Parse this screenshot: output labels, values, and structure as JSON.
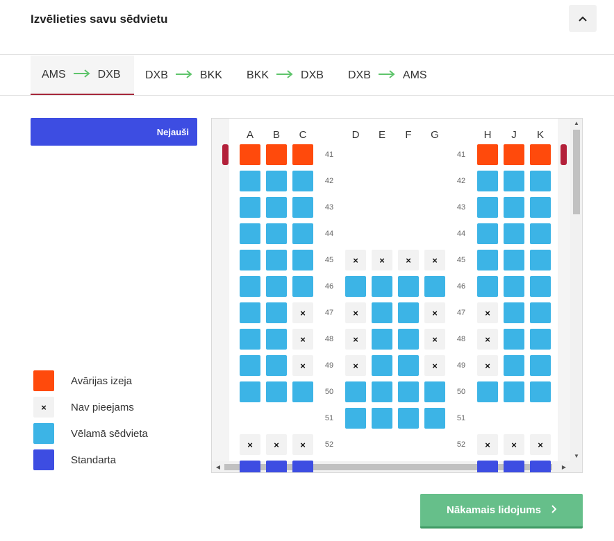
{
  "header": {
    "title": "Izvēlieties savu sēdvietu",
    "collapse_icon": "chevron-up-icon"
  },
  "flight_tabs": [
    {
      "from": "AMS",
      "to": "DXB",
      "active": true
    },
    {
      "from": "DXB",
      "to": "BKK",
      "active": false
    },
    {
      "from": "BKK",
      "to": "DXB",
      "active": false
    },
    {
      "from": "DXB",
      "to": "AMS",
      "active": false
    }
  ],
  "random_button": {
    "label": "Nejauši"
  },
  "legend": [
    {
      "type": "exit",
      "label": "Avārijas izeja"
    },
    {
      "type": "unavailable",
      "label": "Nav pieejams",
      "symbol": "×"
    },
    {
      "type": "preferred",
      "label": "Vēlamā sēdvieta"
    },
    {
      "type": "standard",
      "label": "Standarta"
    }
  ],
  "seat_map": {
    "columns": [
      "A",
      "B",
      "C",
      "D",
      "E",
      "F",
      "G",
      "H",
      "J",
      "K"
    ],
    "unavailable_symbol": "×",
    "rows": [
      {
        "number": "41",
        "seats": {
          "A": "exit",
          "B": "exit",
          "C": "exit",
          "H": "exit",
          "J": "exit",
          "K": "exit"
        }
      },
      {
        "number": "42",
        "seats": {
          "A": "preferred",
          "B": "preferred",
          "C": "preferred",
          "H": "preferred",
          "J": "preferred",
          "K": "preferred"
        }
      },
      {
        "number": "43",
        "seats": {
          "A": "preferred",
          "B": "preferred",
          "C": "preferred",
          "H": "preferred",
          "J": "preferred",
          "K": "preferred"
        }
      },
      {
        "number": "44",
        "seats": {
          "A": "preferred",
          "B": "preferred",
          "C": "preferred",
          "H": "preferred",
          "J": "preferred",
          "K": "preferred"
        }
      },
      {
        "number": "45",
        "seats": {
          "A": "preferred",
          "B": "preferred",
          "C": "preferred",
          "D": "unavailable",
          "E": "unavailable",
          "F": "unavailable",
          "G": "unavailable",
          "H": "preferred",
          "J": "preferred",
          "K": "preferred"
        }
      },
      {
        "number": "46",
        "seats": {
          "A": "preferred",
          "B": "preferred",
          "C": "preferred",
          "D": "preferred",
          "E": "preferred",
          "F": "preferred",
          "G": "preferred",
          "H": "preferred",
          "J": "preferred",
          "K": "preferred"
        }
      },
      {
        "number": "47",
        "seats": {
          "A": "preferred",
          "B": "preferred",
          "C": "unavailable",
          "D": "unavailable",
          "E": "preferred",
          "F": "preferred",
          "G": "unavailable",
          "H": "unavailable",
          "J": "preferred",
          "K": "preferred"
        }
      },
      {
        "number": "48",
        "seats": {
          "A": "preferred",
          "B": "preferred",
          "C": "unavailable",
          "D": "unavailable",
          "E": "preferred",
          "F": "preferred",
          "G": "unavailable",
          "H": "unavailable",
          "J": "preferred",
          "K": "preferred"
        }
      },
      {
        "number": "49",
        "seats": {
          "A": "preferred",
          "B": "preferred",
          "C": "unavailable",
          "D": "unavailable",
          "E": "preferred",
          "F": "preferred",
          "G": "unavailable",
          "H": "unavailable",
          "J": "preferred",
          "K": "preferred"
        }
      },
      {
        "number": "50",
        "seats": {
          "A": "preferred",
          "B": "preferred",
          "C": "preferred",
          "D": "preferred",
          "E": "preferred",
          "F": "preferred",
          "G": "preferred",
          "H": "preferred",
          "J": "preferred",
          "K": "preferred"
        }
      },
      {
        "number": "51",
        "seats": {
          "D": "preferred",
          "E": "preferred",
          "F": "preferred",
          "G": "preferred"
        }
      },
      {
        "number": "52",
        "seats": {
          "A": "unavailable",
          "B": "unavailable",
          "C": "unavailable",
          "H": "unavailable",
          "J": "unavailable",
          "K": "unavailable"
        }
      },
      {
        "number": "",
        "seats": {
          "A": "standard",
          "B": "standard",
          "C": "standard",
          "H": "standard",
          "J": "standard",
          "K": "standard"
        }
      }
    ]
  },
  "next_button": {
    "label": "Nākamais lidojums",
    "icon": "chevron-right-icon"
  },
  "colors": {
    "exit": "#ff4a0c",
    "preferred": "#3cb4e6",
    "standard": "#3d4de2",
    "unavailable": "#f2f2f2",
    "route_arrow": "#5ec46b",
    "next_button": "#66bf8a",
    "exit_marker": "#b3203a"
  }
}
